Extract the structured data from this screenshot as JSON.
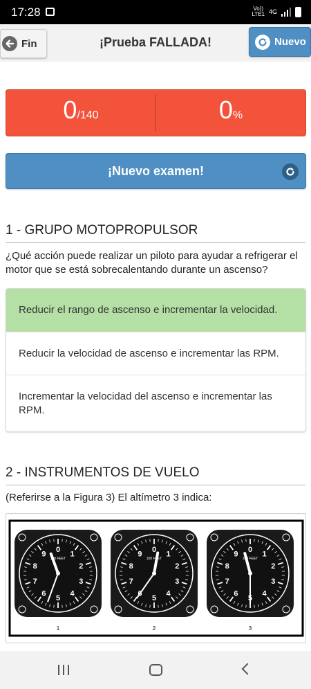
{
  "status_bar": {
    "time": "17:28",
    "network_top": "Vo))",
    "network_bottom": "LTE1",
    "network_type": "4G"
  },
  "header": {
    "back_label": "Fin",
    "title": "¡Prueba FALLADA!",
    "new_label": "Nuevo"
  },
  "score": {
    "correct": "0",
    "total": "/140",
    "percent": "0",
    "percent_unit": "%"
  },
  "new_exam_label": "¡Nuevo examen!",
  "questions": [
    {
      "title": "1 - GRUPO MOTOPROPULSOR",
      "text": "¿Qué acción puede realizar un piloto para ayudar a refrigerar el motor que se está sobrecalentando durante un ascenso?",
      "answers": [
        {
          "text": "Reducir el rango de ascenso e incrementar la velocidad.",
          "correct": true
        },
        {
          "text": "Reducir la velocidad de ascenso e incrementar las RPM.",
          "correct": false
        },
        {
          "text": "Incrementar la velocidad del ascenso e incrementar las RPM.",
          "correct": false
        }
      ]
    },
    {
      "title": "2 - INSTRUMENTOS DE VUELO",
      "text": "(Referirse a la Figura 3) El altímetro 3 indica:",
      "figure": {
        "dial_numbers": [
          "0",
          "1",
          "2",
          "3",
          "4",
          "5",
          "6",
          "7",
          "8",
          "9"
        ],
        "dial_caption": "100 FEET",
        "instrument_labels": [
          "1",
          "2",
          "3"
        ]
      }
    }
  ],
  "colors": {
    "fail": "#f4533b",
    "primary": "#4f8fc4",
    "correct": "#b4dfa5"
  }
}
